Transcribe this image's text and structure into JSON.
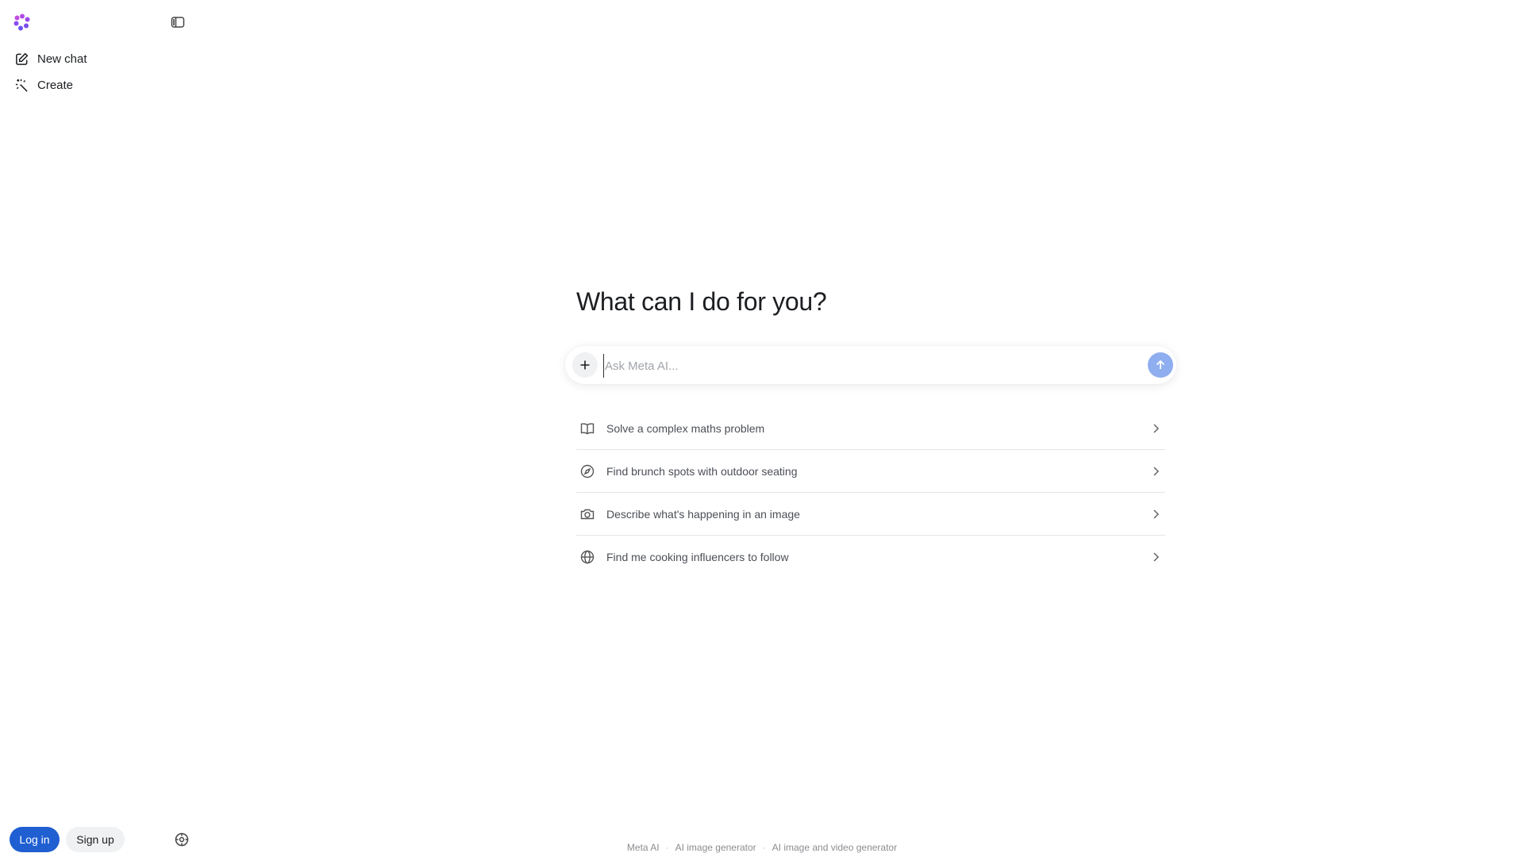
{
  "sidebar": {
    "logo_icon": "meta-ai-logo-icon",
    "toggle_icon": "sidebar-toggle-icon",
    "items": [
      {
        "label": "New chat",
        "icon": "edit-icon"
      },
      {
        "label": "Create",
        "icon": "magic-wand-icon"
      }
    ],
    "login_label": "Log in",
    "signup_label": "Sign up",
    "settings_icon": "settings-icon"
  },
  "main": {
    "headline": "What can I do for you?",
    "composer": {
      "placeholder": "Ask Meta AI...",
      "value": ""
    },
    "suggestions": [
      {
        "label": "Solve a complex maths problem",
        "icon": "book-icon"
      },
      {
        "label": "Find brunch spots with outdoor seating",
        "icon": "compass-icon"
      },
      {
        "label": "Describe what's happening in an image",
        "icon": "camera-icon"
      },
      {
        "label": "Find me cooking influencers to follow",
        "icon": "globe-icon"
      }
    ]
  },
  "footer": {
    "links": [
      "Meta AI",
      "AI image generator",
      "AI image and video generator"
    ],
    "separator": "·"
  },
  "colors": {
    "primary": "#1f5fd1",
    "send_button": "#8faef0",
    "text": "#1c1e21",
    "muted": "#8a8d91"
  }
}
